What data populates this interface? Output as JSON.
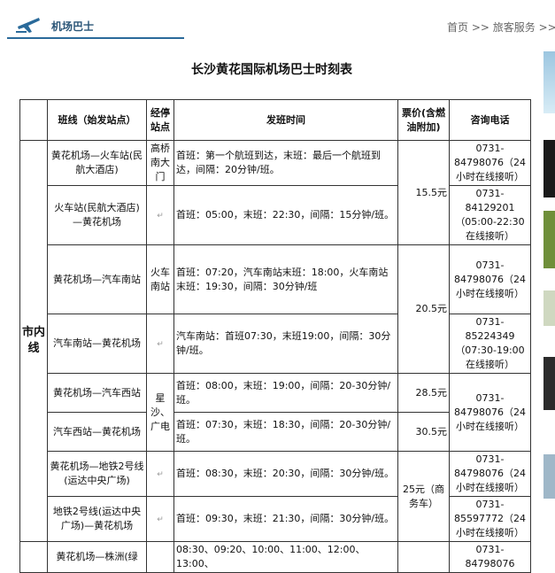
{
  "header": {
    "section_title": "机场巴士",
    "breadcrumb": [
      "首页",
      ">>",
      "旅客服务",
      ">>"
    ]
  },
  "page_title": "长沙黄花国际机场巴士时刻表",
  "table": {
    "headers": {
      "route": "班线（始发站点）",
      "stops": "经停站点",
      "schedule": "发班时间",
      "price": "票价(含燃油附加)",
      "phone": "咨询电话"
    },
    "zone_label": "市内线",
    "rows": [
      {
        "route": "黄花机场—火车站(民航大酒店)",
        "stops": "高桥南大门",
        "schedule": "首班：第一个航班到达，末班：最后一个航班到达，间隔：20分钟/班。",
        "price": "15.5元",
        "phone": "0731-84798076（24小时在线接听）"
      },
      {
        "route": "火车站(民航大酒店)—黄花机场",
        "stops": "",
        "schedule": "首班：05:00，末班：22:30，间隔：15分钟/班。",
        "price": "",
        "phone": "0731-84129201（05:00-22:30在线接听）"
      },
      {
        "route": "黄花机场—汽车南站",
        "stops": "火车南站",
        "schedule": "首班：07:20，汽车南站末班：18:00，火车南站末班：19:30，间隔：30分钟/班",
        "price": "20.5元",
        "phone": "0731-84798076（24小时在线接听）"
      },
      {
        "route": "汽车南站—黄花机场",
        "stops": "",
        "schedule": "汽车南站：首班07:30，末班19:00，间隔：30分钟/班。",
        "price": "",
        "phone": "0731-85224349（07:30-19:00在线接听）"
      },
      {
        "route": "黄花机场—汽车西站",
        "stops": "星沙、广电",
        "schedule": "首班：08:00，末班：19:00，间隔：20-30分钟/班。",
        "price": "28.5元",
        "phone": "0731-84798076（24小时在线接听）"
      },
      {
        "route": "汽车西站—黄花机场",
        "stops": "",
        "schedule": "首班：07:30，末班：18:30，间隔：20-30分钟/班。",
        "price": "30.5元",
        "phone": ""
      },
      {
        "route": "黄花机场—地铁2号线(运达中央广场)",
        "stops": "",
        "schedule": "首班：08:30，末班：20:30，间隔：30分钟/班。",
        "price": "25元（商务车）",
        "phone": "0731-84798076（24小时在线接听）"
      },
      {
        "route": "地铁2号线(运达中央广场)—黄花机场",
        "stops": "",
        "schedule": "首班：09:30，末班：21:30，间隔：30分钟/班。",
        "price": "",
        "phone": "0731-85597772（24小时在线接听）"
      },
      {
        "route": "黄花机场—株洲(绿",
        "stops": "",
        "schedule": "08:30、09:20、10:00、11:00、12:00、13:00、",
        "price": "",
        "phone": "0731-84798076"
      }
    ]
  },
  "colors": {
    "accent": "#2a6a9a",
    "breadcrumb": "#666666"
  },
  "icons": {
    "plane": "plane-icon"
  }
}
